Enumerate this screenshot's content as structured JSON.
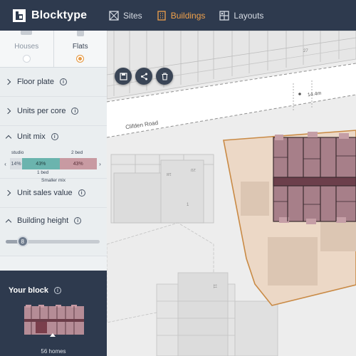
{
  "app": {
    "name": "Blocktype"
  },
  "nav": [
    {
      "label": "Sites",
      "icon": "sites-icon",
      "active": false
    },
    {
      "label": "Buildings",
      "icon": "buildings-icon",
      "active": true
    },
    {
      "label": "Layouts",
      "icon": "layouts-icon",
      "active": false
    }
  ],
  "building_type": {
    "options": [
      {
        "label": "Houses",
        "selected": false
      },
      {
        "label": "Flats",
        "selected": true
      }
    ]
  },
  "sections": {
    "floor_plate": "Floor plate",
    "units_per_core": "Units per core",
    "unit_mix": "Unit mix",
    "unit_sales_value": "Unit sales value",
    "building_height": "Building height"
  },
  "unit_mix": {
    "studio_label": "studio",
    "one_bed_label": "1 bed",
    "two_bed_label": "2 bed",
    "studio_pct": "14%",
    "one_bed_pct": "43%",
    "two_bed_pct": "43%",
    "caption": "Smaller mix",
    "values": {
      "studio": 14,
      "one_bed": 43,
      "two_bed": 43
    }
  },
  "building_height": {
    "value": "8",
    "fraction": 0.18
  },
  "your_block": {
    "title": "Your block",
    "homes": "56 homes"
  },
  "map": {
    "road_name": "Clifden Road",
    "measurement": "14.4m",
    "plot_numbers": [
      "13",
      "27",
      "18",
      "20",
      "1",
      "11"
    ]
  },
  "map_tools": [
    "save-icon",
    "share-icon",
    "delete-icon"
  ],
  "colors": {
    "brand_dark": "#2e3a4e",
    "accent": "#e69a45",
    "site_fill": "#ecd8c6",
    "building": "#a77f89"
  }
}
